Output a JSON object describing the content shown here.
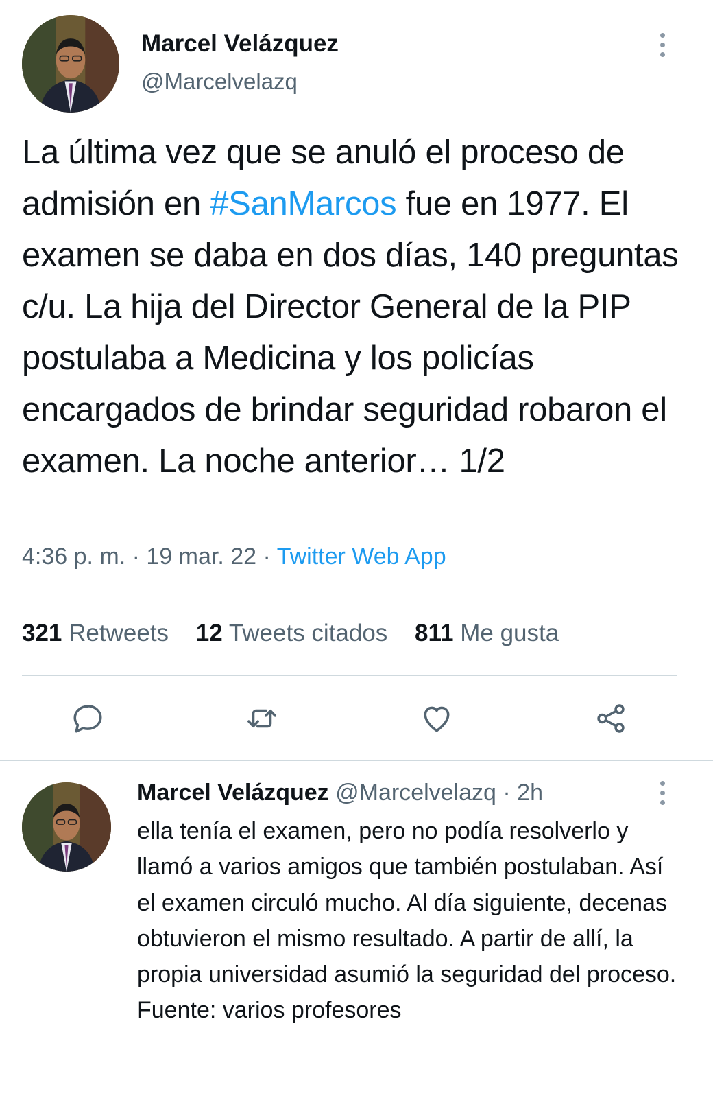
{
  "main_tweet": {
    "author_name": "Marcel Velázquez",
    "author_handle": "@Marcelvelazq",
    "text_before_hashtag": "La última vez que se anuló el proceso de admisión en ",
    "hashtag": "#SanMarcos",
    "text_after_hashtag": " fue en 1977. El examen se daba en dos días, 140 preguntas c/u. La hija del Director General de la PIP postulaba a Medicina y los policías encargados de brindar seguridad robaron el examen. La noche anterior… 1/2",
    "time": "4:36 p. m.",
    "date": "19 mar. 22",
    "separator": " · ",
    "source": "Twitter Web App",
    "stats": {
      "retweets_count": "321",
      "retweets_label": "Retweets",
      "quotes_count": "12",
      "quotes_label": "Tweets citados",
      "likes_count": "811",
      "likes_label": "Me gusta"
    },
    "actions": [
      "reply-icon",
      "retweet-icon",
      "like-icon",
      "share-icon"
    ]
  },
  "reply_tweet": {
    "author_name": "Marcel Velázquez",
    "author_handle": "@Marcelvelazq",
    "time_sep": " · ",
    "time_ago": "2h",
    "text": "ella tenía el examen, pero no podía resolverlo y llamó a varios amigos que también postulaban. Así el examen circuló mucho. Al día siguiente, decenas obtuvieron el mismo resultado. A partir de allí, la propia universidad asumió la seguridad del proceso. Fuente: varios profesores"
  },
  "colors": {
    "link": "#1d9bf0",
    "secondary_text": "#536471",
    "primary_text": "#0f1419",
    "icon": "#536471"
  }
}
